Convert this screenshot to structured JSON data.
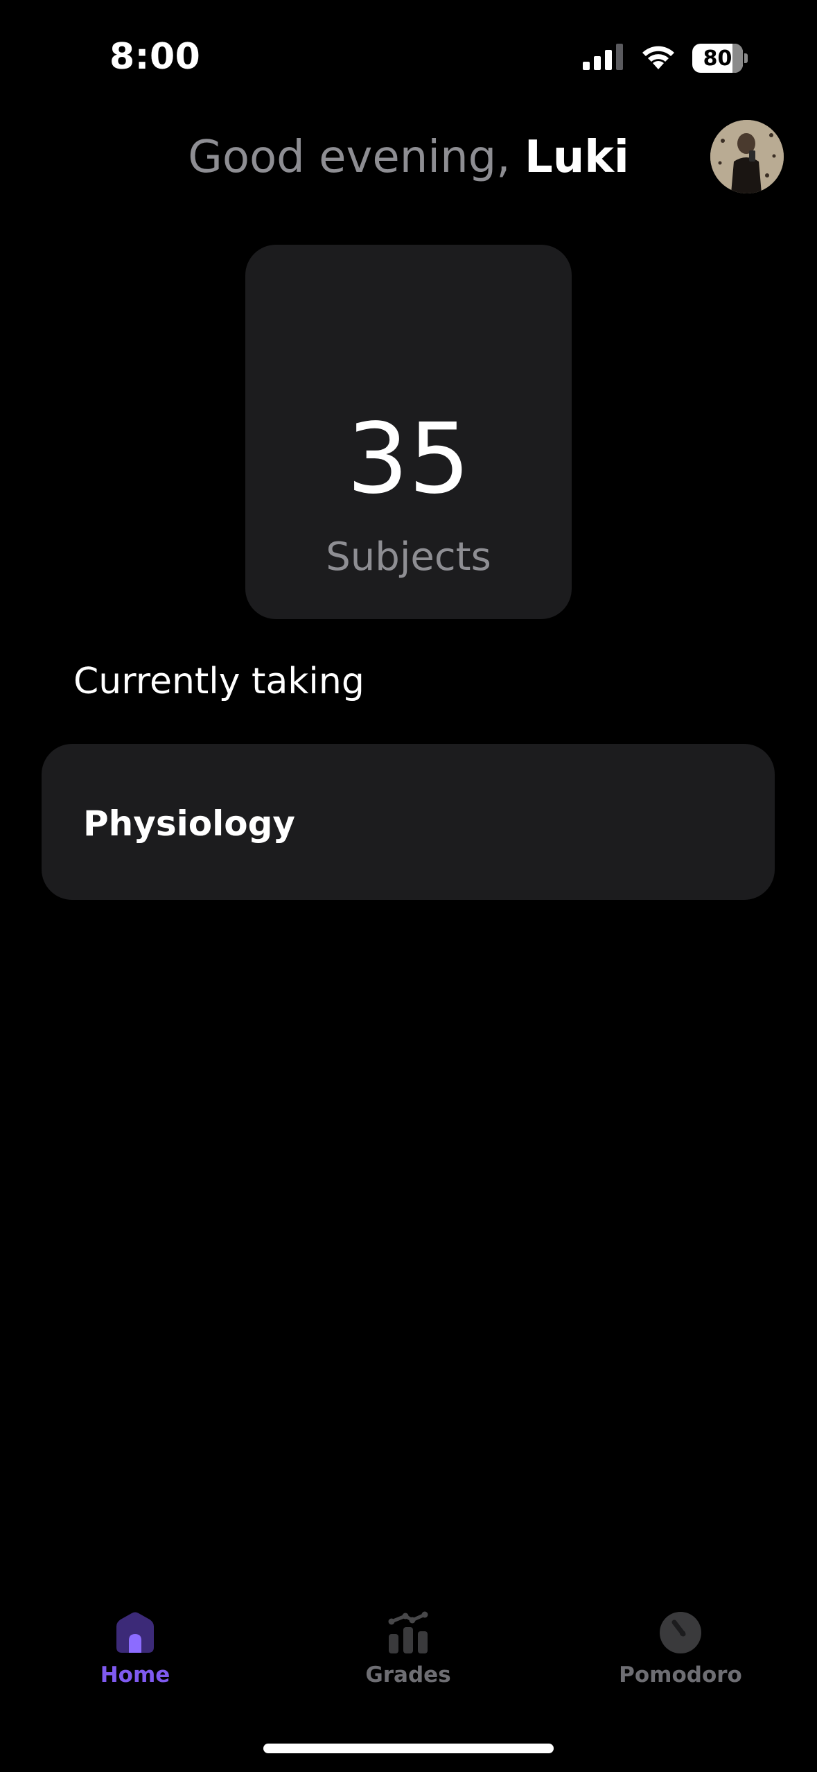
{
  "status_bar": {
    "time": "8:00",
    "battery_level": "80",
    "battery_fraction": 0.8
  },
  "header": {
    "greeting": "Good evening,",
    "user_name": "Luki",
    "avatar_icon": "profile-photo"
  },
  "stats": {
    "subject_count": "35",
    "subject_label": "Subjects"
  },
  "current": {
    "section_title": "Currently taking",
    "subjects": [
      "Physiology"
    ]
  },
  "tab_bar": {
    "tabs": [
      {
        "label": "Home",
        "icon": "home-icon",
        "active": true
      },
      {
        "label": "Grades",
        "icon": "bar-chart-icon",
        "active": false
      },
      {
        "label": "Pomodoro",
        "icon": "timer-icon",
        "active": false
      }
    ]
  },
  "colors": {
    "accent": "#7f5af0",
    "background": "#000000",
    "card": "#1c1c1e",
    "muted_text": "#8e8e93",
    "inactive_icon": "#3a3a3c"
  }
}
